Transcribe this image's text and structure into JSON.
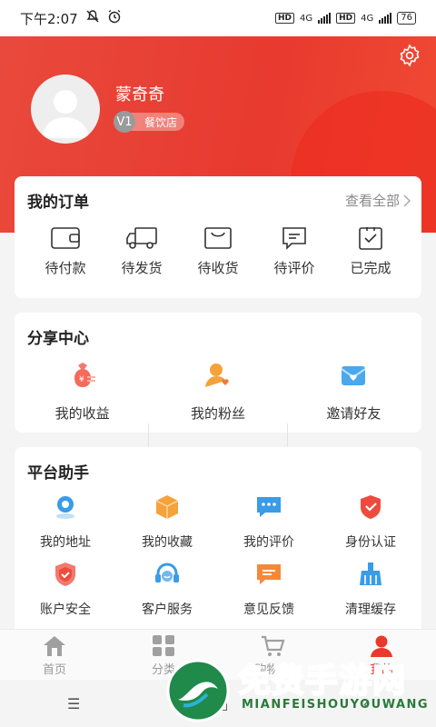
{
  "status_bar": {
    "time": "下午2:07",
    "network_1": "4G",
    "network_2": "4G",
    "hd": "HD",
    "battery": "76"
  },
  "header": {
    "username": "蒙奇奇",
    "level": "V1",
    "level_name": "餐饮店"
  },
  "orders": {
    "title": "我的订单",
    "view_all": "查看全部",
    "items": [
      {
        "label": "待付款",
        "icon": "wallet-icon"
      },
      {
        "label": "待发货",
        "icon": "truck-icon"
      },
      {
        "label": "待收货",
        "icon": "package-icon"
      },
      {
        "label": "待评价",
        "icon": "comment-icon"
      },
      {
        "label": "已完成",
        "icon": "check-clipboard-icon"
      }
    ]
  },
  "share": {
    "title": "分享中心",
    "items": [
      {
        "label": "我的收益",
        "icon": "money-bag-icon"
      },
      {
        "label": "我的粉丝",
        "icon": "fans-icon"
      },
      {
        "label": "邀请好友",
        "icon": "invite-mail-icon"
      }
    ]
  },
  "assistant": {
    "title": "平台助手",
    "items": [
      {
        "label": "我的地址",
        "icon": "location-icon"
      },
      {
        "label": "我的收藏",
        "icon": "box-icon"
      },
      {
        "label": "我的评价",
        "icon": "chat-icon"
      },
      {
        "label": "身份认证",
        "icon": "shield-check-icon"
      },
      {
        "label": "账户安全",
        "icon": "security-shield-icon"
      },
      {
        "label": "客户服务",
        "icon": "headset-icon"
      },
      {
        "label": "意见反馈",
        "icon": "feedback-icon"
      },
      {
        "label": "清理缓存",
        "icon": "broom-icon"
      }
    ]
  },
  "bottom_nav": {
    "items": [
      {
        "label": "首页",
        "icon": "home-icon"
      },
      {
        "label": "分类",
        "icon": "grid-icon"
      },
      {
        "label": "购物车",
        "icon": "cart-icon"
      },
      {
        "label": "我的",
        "icon": "user-icon"
      }
    ],
    "active": "我的"
  },
  "watermark": {
    "title": "免费手游网",
    "subtitle": "MIANFEISHOUYOUWANG"
  },
  "colors": {
    "brand_red": "#e8392c",
    "accent_orange": "#f5a23a",
    "accent_blue": "#3aa0e8"
  }
}
